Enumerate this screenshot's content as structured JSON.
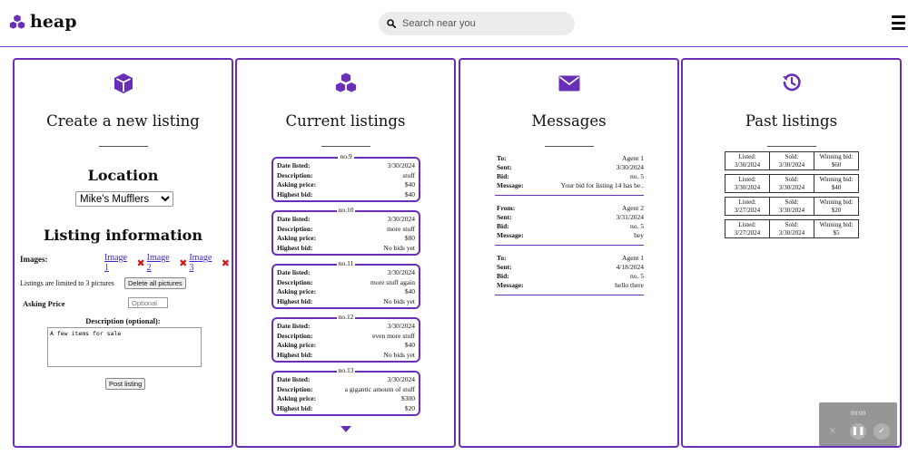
{
  "header": {
    "logo_text": "heap",
    "search_placeholder": "Search near you"
  },
  "create": {
    "title": "Create a new listing",
    "location_title": "Location",
    "location_value": "Mike's Mufflers",
    "info_title": "Listing information",
    "images_label": "Images:",
    "images": [
      "Image 1",
      "Image 2",
      "Image 3"
    ],
    "limit_text": "Listings are limited to 3 pictures",
    "delete_all_label": "Delete all pictures",
    "asking_price_label": "Asking Price",
    "asking_price_placeholder": "Optional",
    "description_label": "Description (optional):",
    "description_value": "A few items for sale",
    "post_label": "Post listing"
  },
  "current": {
    "title": "Current listings",
    "field_labels": {
      "date": "Date listed:",
      "description": "Description:",
      "price": "Asking price:",
      "bid": "Highest bid:"
    },
    "items": [
      {
        "no": "no.9",
        "date": "3/30/2024",
        "description": "stuff",
        "price": "$40",
        "bid": "$40"
      },
      {
        "no": "no.10",
        "date": "3/30/2024",
        "description": "more stuff",
        "price": "$80",
        "bid": "No bids yet"
      },
      {
        "no": "no.11",
        "date": "3/30/2024",
        "description": "more stuff again",
        "price": "$40",
        "bid": "No bids yet"
      },
      {
        "no": "no.12",
        "date": "3/30/2024",
        "description": "even more stuff",
        "price": "$40",
        "bid": "No bids yet"
      },
      {
        "no": "no.13",
        "date": "3/30/2024",
        "description": "a gigantic amoutn of stuff",
        "price": "$300",
        "bid": "$20"
      }
    ]
  },
  "messages": {
    "title": "Messages",
    "items": [
      {
        "party_label": "To:",
        "party": "Agent 1",
        "sent_label": "Sent:",
        "sent": "3/30/2024",
        "bid_label": "Bid:",
        "bid": "no. 5",
        "message_label": "Message:",
        "message": "Your bid for listing 14 has be.."
      },
      {
        "party_label": "From:",
        "party": "Agent 2",
        "sent_label": "Sent:",
        "sent": "3/31/2024",
        "bid_label": "Bid:",
        "bid": "no. 5",
        "message_label": "Message:",
        "message": "hey"
      },
      {
        "party_label": "To:",
        "party": "Agent 1",
        "sent_label": "Sent:",
        "sent": "4/18/2024",
        "bid_label": "Bid:",
        "bid": "no. 5",
        "message_label": "Message:",
        "message": "hello there"
      }
    ]
  },
  "past": {
    "title": "Past listings",
    "labels": {
      "listed": "Listed:",
      "sold": "Sold:",
      "winning": "Winning bid:"
    },
    "items": [
      {
        "listed": "3/30/2024",
        "sold": "3/30/2024",
        "winning": "$60"
      },
      {
        "listed": "3/30/2024",
        "sold": "3/30/2024",
        "winning": "$40"
      },
      {
        "listed": "3/27/2024",
        "sold": "3/30/2024",
        "winning": "$20"
      },
      {
        "listed": "3/27/2024",
        "sold": "3/30/2024",
        "winning": "$5"
      }
    ]
  },
  "recorder": {
    "time": "00:00"
  },
  "colors": {
    "accent": "#6a2fb8",
    "remove": "#d31a1a",
    "link": "#3b27c9"
  },
  "icons": {
    "logo": "cubes-icon",
    "create": "cube-icon",
    "current": "cubes-icon",
    "messages": "envelope-icon",
    "past": "history-icon"
  }
}
